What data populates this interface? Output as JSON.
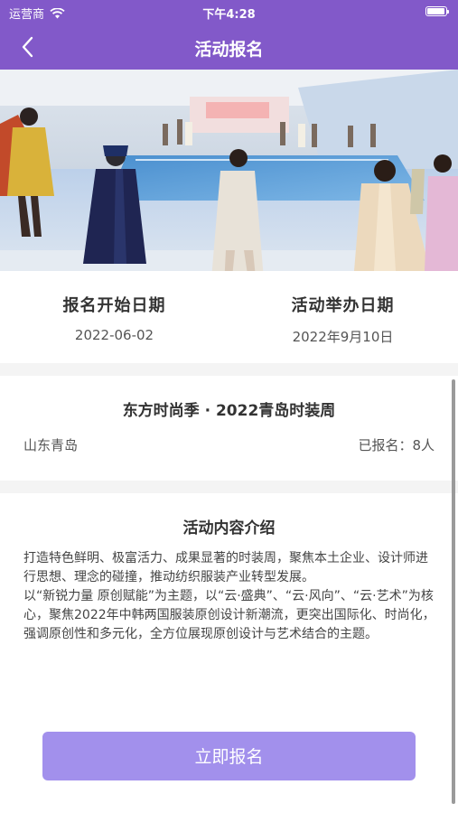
{
  "status_bar": {
    "carrier": "运营商",
    "time": "下午4:28"
  },
  "nav": {
    "title": "活动报名"
  },
  "dates": {
    "signup_start_label": "报名开始日期",
    "signup_start_value": "2022-06-02",
    "event_date_label": "活动举办日期",
    "event_date_value": "2022年9月10日"
  },
  "event": {
    "title": "东方时尚季 · 2022青岛时装周",
    "location": "山东青岛",
    "registered": "已报名：8人"
  },
  "intro": {
    "title": "活动内容介绍",
    "paragraphs": [
      "打造特色鲜明、极富活力、成果显著的时装周，聚焦本土企业、设计师进行思想、理念的碰撞，推动纺织服装产业转型发展。",
      "以“新锐力量 原创赋能”为主题，以“云·盛典”、“云·风向”、“云·艺术”为核心，聚焦2022年中韩两国服装原创设计新潮流，更突出国际化、时尚化，强调原创性和多元化，全方位展现原创设计与艺术结合的主题。"
    ]
  },
  "signup_button": "立即报名",
  "icons": {
    "back": "chevron-left-icon",
    "wifi": "wifi-icon",
    "battery": "battery-icon"
  },
  "colors": {
    "header": "#8259c9",
    "button": "#a290ec",
    "background": "#f4f4f4"
  }
}
